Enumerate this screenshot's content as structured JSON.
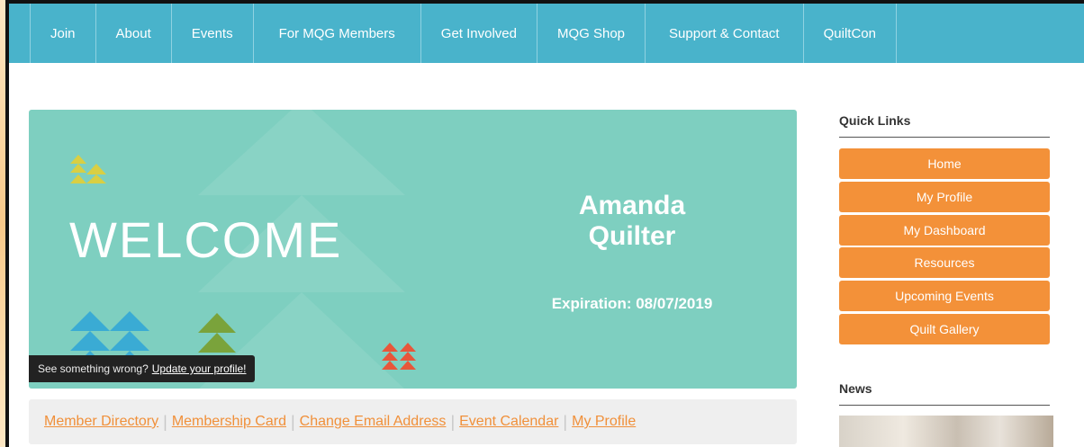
{
  "nav": {
    "items": [
      "Join",
      "About",
      "Events",
      "For MQG Members",
      "Get Involved",
      "MQG Shop",
      "Support & Contact",
      "QuiltCon"
    ]
  },
  "banner": {
    "welcome": "WELCOME",
    "name_first": "Amanda",
    "name_last": "Quilter",
    "expiration": "Expiration: 08/07/2019",
    "tooltip_text": "See something wrong?",
    "tooltip_link": "Update your profile!"
  },
  "member_links": [
    "Member Directory",
    "Membership Card",
    "Change Email Address",
    "Event Calendar",
    "My Profile"
  ],
  "sidebar": {
    "quick_links_title": "Quick Links",
    "quick_links": [
      "Home",
      "My Profile",
      "My Dashboard",
      "Resources",
      "Upcoming Events",
      "Quilt Gallery"
    ],
    "news_title": "News"
  },
  "colors": {
    "nav_bg": "#49b3cb",
    "banner_bg": "#7ecfc0",
    "accent_orange": "#f39139",
    "link_orange": "#f0903a"
  }
}
